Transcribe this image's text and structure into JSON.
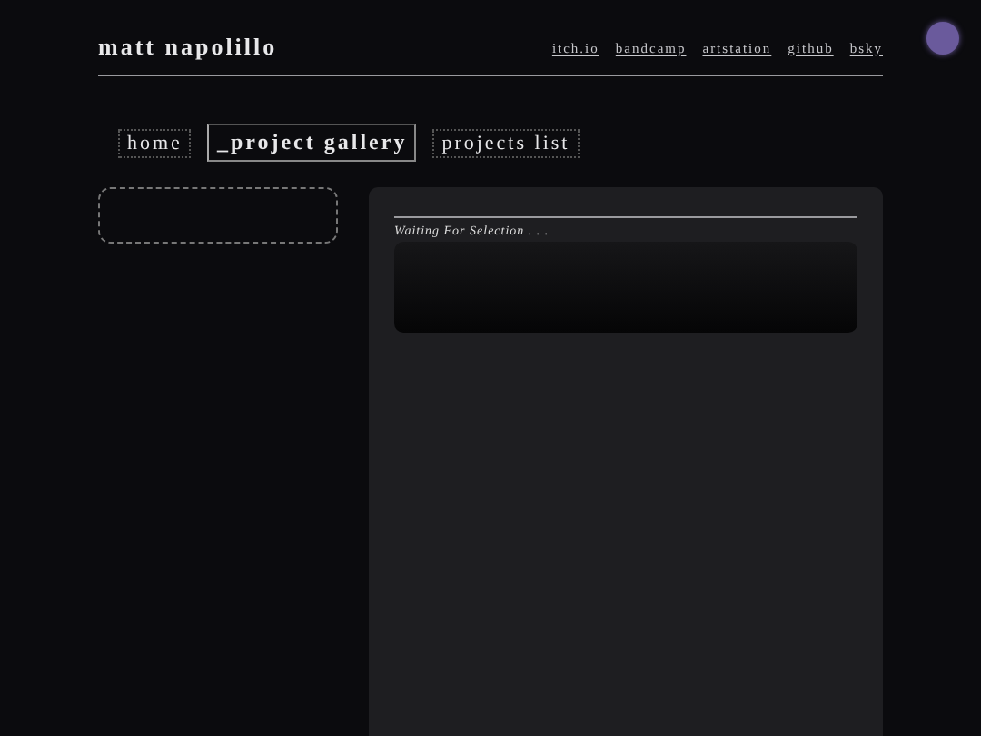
{
  "site_title": "matt napolillo",
  "links": [
    "itch.io",
    "bandcamp",
    "artstation",
    "github",
    "bsky"
  ],
  "tabs": [
    {
      "label": "home",
      "selected": false
    },
    {
      "label": "_project gallery",
      "selected": true
    },
    {
      "label": "projects list",
      "selected": false
    }
  ],
  "viewer": {
    "status": "Waiting For Selection . . ."
  }
}
